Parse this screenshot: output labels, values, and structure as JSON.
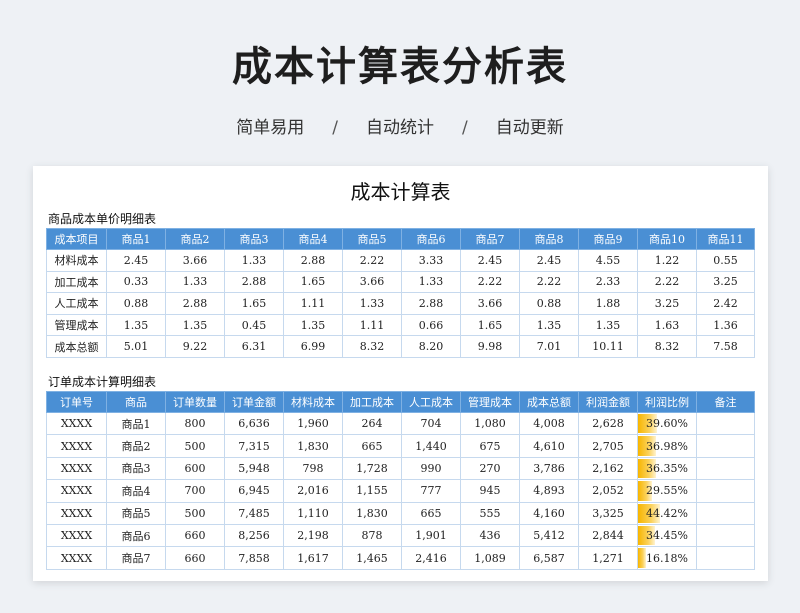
{
  "hero": {
    "title": "成本计算表分析表",
    "tags": [
      "简单易用",
      "自动统计",
      "自动更新"
    ],
    "separator": "/"
  },
  "sheet": {
    "title": "成本计算表",
    "unit_cost": {
      "label": "商品成本单价明细表",
      "headers": [
        "成本项目",
        "商品1",
        "商品2",
        "商品3",
        "商品4",
        "商品5",
        "商品6",
        "商品7",
        "商品8",
        "商品9",
        "商品10",
        "商品11"
      ],
      "rows": [
        [
          "材料成本",
          "2.45",
          "3.66",
          "1.33",
          "2.88",
          "2.22",
          "3.33",
          "2.45",
          "2.45",
          "4.55",
          "1.22",
          "0.55"
        ],
        [
          "加工成本",
          "0.33",
          "1.33",
          "2.88",
          "1.65",
          "3.66",
          "1.33",
          "2.22",
          "2.22",
          "2.33",
          "2.22",
          "3.25"
        ],
        [
          "人工成本",
          "0.88",
          "2.88",
          "1.65",
          "1.11",
          "1.33",
          "2.88",
          "3.66",
          "0.88",
          "1.88",
          "3.25",
          "2.42"
        ],
        [
          "管理成本",
          "1.35",
          "1.35",
          "0.45",
          "1.35",
          "1.11",
          "0.66",
          "1.65",
          "1.35",
          "1.35",
          "1.63",
          "1.36"
        ],
        [
          "成本总额",
          "5.01",
          "9.22",
          "6.31",
          "6.99",
          "8.32",
          "8.20",
          "9.98",
          "7.01",
          "10.11",
          "8.32",
          "7.58"
        ]
      ]
    },
    "orders": {
      "label": "订单成本计算明细表",
      "headers": [
        "订单号",
        "商品",
        "订单数量",
        "订单金额",
        "材料成本",
        "加工成本",
        "人工成本",
        "管理成本",
        "成本总额",
        "利润金额",
        "利润比例",
        "备注"
      ],
      "rows": [
        {
          "cells": [
            "XXXX",
            "商品1",
            "800",
            "6,636",
            "1,960",
            "264",
            "704",
            "1,080",
            "4,008",
            "2,628"
          ],
          "ratio": "39.60%",
          "ratio_value": 0.396,
          "note": ""
        },
        {
          "cells": [
            "XXXX",
            "商品2",
            "500",
            "7,315",
            "1,830",
            "665",
            "1,440",
            "675",
            "4,610",
            "2,705"
          ],
          "ratio": "36.98%",
          "ratio_value": 0.3698,
          "note": ""
        },
        {
          "cells": [
            "XXXX",
            "商品3",
            "600",
            "5,948",
            "798",
            "1,728",
            "990",
            "270",
            "3,786",
            "2,162"
          ],
          "ratio": "36.35%",
          "ratio_value": 0.3635,
          "note": ""
        },
        {
          "cells": [
            "XXXX",
            "商品4",
            "700",
            "6,945",
            "2,016",
            "1,155",
            "777",
            "945",
            "4,893",
            "2,052"
          ],
          "ratio": "29.55%",
          "ratio_value": 0.2955,
          "note": ""
        },
        {
          "cells": [
            "XXXX",
            "商品5",
            "500",
            "7,485",
            "1,110",
            "1,830",
            "665",
            "555",
            "4,160",
            "3,325"
          ],
          "ratio": "44.42%",
          "ratio_value": 0.4442,
          "note": ""
        },
        {
          "cells": [
            "XXXX",
            "商品6",
            "660",
            "8,256",
            "2,198",
            "878",
            "1,901",
            "436",
            "5,412",
            "2,844"
          ],
          "ratio": "34.45%",
          "ratio_value": 0.3445,
          "note": ""
        },
        {
          "cells": [
            "XXXX",
            "商品7",
            "660",
            "7,858",
            "1,617",
            "1,465",
            "2,416",
            "1,089",
            "6,587",
            "1,271"
          ],
          "ratio": "16.18%",
          "ratio_value": 0.1618,
          "note": ""
        }
      ]
    }
  },
  "colors": {
    "header_blue": "#4a8fd4",
    "ratio_bar": "#f7b500"
  }
}
